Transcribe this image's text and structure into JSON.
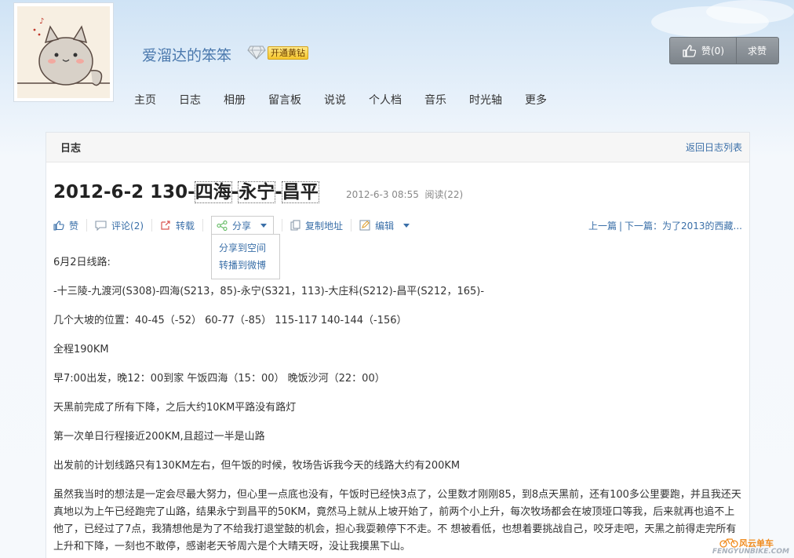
{
  "header": {
    "site_name": "爱溜达的笨笨",
    "vip_badge": "开通黄钻",
    "like_label": "赞(0)",
    "ask_label": "求赞"
  },
  "nav": [
    {
      "label": "主页"
    },
    {
      "label": "日志"
    },
    {
      "label": "相册"
    },
    {
      "label": "留言板"
    },
    {
      "label": "说说"
    },
    {
      "label": "个人档"
    },
    {
      "label": "音乐"
    },
    {
      "label": "时光轴"
    },
    {
      "label": "更多"
    }
  ],
  "panel": {
    "title": "日志",
    "back_link": "返回日志列表"
  },
  "post": {
    "title_date": "2012-6-2 130-",
    "title_sel1": "四海",
    "title_dash1": "-",
    "title_sel2": "永宁",
    "title_dash2": "-",
    "title_sel3": "昌平",
    "date": "2012-6-3 08:55",
    "reads": "阅读(22)"
  },
  "toolbar": {
    "like": "赞",
    "comment": "评论(2)",
    "repost": "转载",
    "share": "分享",
    "copy": "复制地址",
    "edit": "编辑",
    "share_menu": [
      "分享到空间",
      "转播到微博"
    ],
    "prev": "上一篇",
    "next": "下一篇：为了2013的西藏..."
  },
  "article": [
    " 6月2日线路:",
    "-十三陵-九渡河(S308)-四海(S213，85)-永宁(S321，113)-大庄科(S212)-昌平(S212，165)-",
    "几个大坡的位置：40-45（-52） 60-77（-85） 115-117 140-144（-156）",
    "全程190KM",
    "早7:00出发，晚12：00到家 午饭四海（15：00） 晚饭沙河（22：00）",
    "天黑前完成了所有下降，之后大约10KM平路没有路灯",
    "第一次单日行程接近200KM,且超过一半是山路",
    "出发前的计划线路只有130KM左右，但午饭的时候，牧场告诉我今天的线路大约有200KM",
    "虽然我当时的想法是一定会尽最大努力，但心里一点底也没有，午饭时已经快3点了，公里数才刚刚85，到8点天黑前，还有100多公里要跑，并且我还天真地以为上午已经跑完了山路，结果永宁到昌平的50KM，竟然马上就从上坡开始了，前两个小上升，每次牧场都会在坡顶垭口等我，后来就再也追不上他了，已经过了7点，我猜想他是为了不给我打退堂鼓的机会，担心我耍赖停下不走。不 想被看低，也想着要挑战自己，咬牙走吧，天黑之前得走完所有上升和下降，一刻也不敢停，感谢老天爷周六是个大晴天呀，没让我摸黑下山。"
  ],
  "watermark": {
    "cn": "风云单车",
    "en": "FENGYUNBIKE.COM"
  }
}
